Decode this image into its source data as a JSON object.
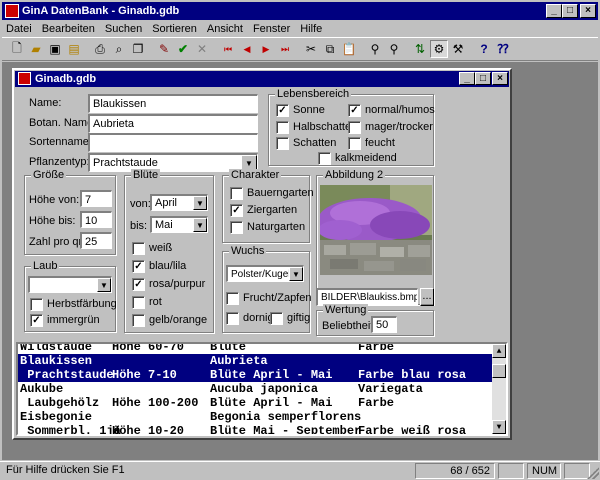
{
  "app": {
    "title": "GinA DatenBank - Ginadb.gdb",
    "menu": [
      "Datei",
      "Bearbeiten",
      "Suchen",
      "Sortieren",
      "Ansicht",
      "Fenster",
      "Hilfe"
    ]
  },
  "doc": {
    "title": "Ginadb.gdb"
  },
  "form": {
    "name_label": "Name:",
    "name_value": "Blaukissen",
    "botan_label": "Botan. Name:",
    "botan_value": "Aubrieta",
    "sorten_label": "Sortenname:",
    "sorten_value": "",
    "pflanzentyp_label": "Pflanzentyp:",
    "pflanzentyp_value": "Prachtstaude"
  },
  "lebensbereich": {
    "title": "Lebensbereich",
    "items": [
      {
        "label": "Sonne",
        "checked": true
      },
      {
        "label": "normal/humos",
        "checked": true
      },
      {
        "label": "Halbschatten",
        "checked": false
      },
      {
        "label": "mager/trocker",
        "checked": false
      },
      {
        "label": "Schatten",
        "checked": false
      },
      {
        "label": "feucht",
        "checked": false
      },
      {
        "label": "kalkmeidend",
        "checked": false
      }
    ]
  },
  "groesse": {
    "title": "Größe",
    "hoehe_von_label": "Höhe von:",
    "hoehe_von_value": "7",
    "hoehe_bis_label": "Höhe bis:",
    "hoehe_bis_value": "10",
    "zahl_label": "Zahl pro qm:",
    "zahl_value": "25"
  },
  "bluete": {
    "title": "Blüte",
    "von_label": "von:",
    "von_value": "April",
    "bis_label": "bis:",
    "bis_value": "Mai",
    "colors": [
      {
        "label": "weiß",
        "checked": false
      },
      {
        "label": "blau/lila",
        "checked": true
      },
      {
        "label": "rosa/purpur",
        "checked": true
      },
      {
        "label": "rot",
        "checked": false
      },
      {
        "label": "gelb/orange",
        "checked": false
      }
    ]
  },
  "charakter": {
    "title": "Charakter",
    "items": [
      {
        "label": "Bauerngarten",
        "checked": false
      },
      {
        "label": "Ziergarten",
        "checked": true
      },
      {
        "label": "Naturgarten",
        "checked": false
      }
    ]
  },
  "abbildung": {
    "title": "Abbildung 2",
    "path": "BILDER\\Blaukiss.bmp",
    "browse": "..."
  },
  "laub": {
    "title": "Laub",
    "value": "",
    "items": [
      {
        "label": "Herbstfärbung",
        "checked": false
      },
      {
        "label": "immergrün",
        "checked": true
      }
    ]
  },
  "wuchs": {
    "title": "Wuchs",
    "value": "Polster/Kugel",
    "items": [
      {
        "label": "Frucht/Zapfen",
        "checked": false
      },
      {
        "label": "dornig",
        "checked": false
      },
      {
        "label": "giftig",
        "checked": false
      }
    ]
  },
  "wertung": {
    "title": "Wertung",
    "label": "Beliebtheit:",
    "value": "50"
  },
  "list": {
    "rows": [
      {
        "c1": "Wildstaude",
        "c2": "Höhe 60-70",
        "c3": "Blüte",
        "c4": "Farbe",
        "sel": false
      },
      {
        "c1": "Blaukissen",
        "c2": "",
        "c3": "Aubrieta",
        "c4": "",
        "sel": true
      },
      {
        "c1": " Prachtstaude",
        "c2": "Höhe 7-10",
        "c3": "Blüte April - Mai",
        "c4": "Farbe blau rosa",
        "sel": true
      },
      {
        "c1": "Aukube",
        "c2": "",
        "c3": "Aucuba japonica",
        "c4": "Variegata",
        "sel": false
      },
      {
        "c1": " Laubgehölz",
        "c2": "Höhe 100-200",
        "c3": "Blüte April - Mai",
        "c4": "Farbe",
        "sel": false
      },
      {
        "c1": "Eisbegonie",
        "c2": "",
        "c3": "Begonia semperflorens",
        "c4": "",
        "sel": false
      },
      {
        "c1": " Sommerbl. 1jä",
        "c2": "Höhe 10-20",
        "c3": "Blüte Mai - September",
        "c4": "Farbe weiß rosa",
        "sel": false
      }
    ]
  },
  "status": {
    "help": "Für Hilfe drücken Sie F1",
    "record": "68 / 652",
    "num": "NUM"
  }
}
